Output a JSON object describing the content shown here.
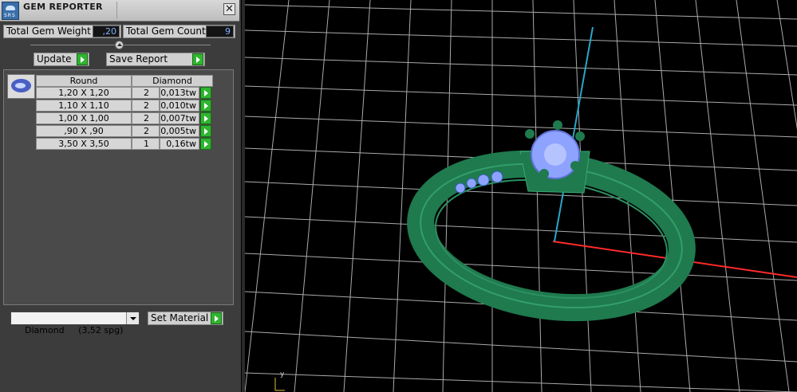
{
  "window": {
    "title": "GEM REPORTER",
    "close_glyph": "✕",
    "app_icon": "gem-reporter-icon",
    "app_icon_text": "SRS"
  },
  "totals": {
    "weight_label": "Total Gem Weight",
    "weight_value": ",20",
    "count_label": "Total Gem Count",
    "count_value": "9"
  },
  "actions": {
    "update_label": "Update",
    "save_label": "Save Report"
  },
  "table": {
    "headers": [
      "Round",
      "Diamond"
    ],
    "rows": [
      {
        "size": "1,20 X 1,20",
        "count": "2",
        "weight": "0,013tw"
      },
      {
        "size": "1,10 X 1,10",
        "count": "2",
        "weight": "0,010tw"
      },
      {
        "size": "1,00 X 1,00",
        "count": "2",
        "weight": "0,007tw"
      },
      {
        "size": ",90 X ,90",
        "count": "2",
        "weight": "0,005tw"
      },
      {
        "size": "3,50 X 3,50",
        "count": "1",
        "weight": "0,16tw"
      }
    ]
  },
  "material": {
    "selected": "Diamond     (3,52 spg)",
    "set_label": "Set Material"
  },
  "viewport": {
    "axis_label": "y",
    "colors": {
      "grid": "#c8c8c8",
      "ring": "#1f7a4e",
      "gem": "#8ea2ff",
      "axis_x": "#ff2a2a",
      "axis_y": "#2aa6c8"
    }
  }
}
